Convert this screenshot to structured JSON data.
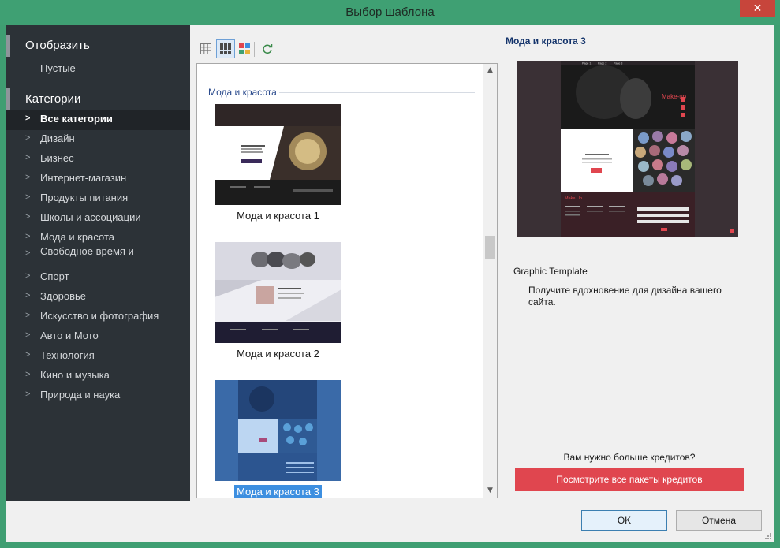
{
  "window": {
    "title": "Выбор шаблона",
    "close_glyph": "✕"
  },
  "sidebar": {
    "display_header": "Отобразить",
    "display_items": [
      "Пустые"
    ],
    "categories_header": "Категории",
    "chevron": ">",
    "categories": [
      {
        "label": "Все категории",
        "selected": true
      },
      {
        "label": "Дизайн"
      },
      {
        "label": "Бизнес"
      },
      {
        "label": "Интернет-магазин"
      },
      {
        "label": "Продукты питания"
      },
      {
        "label": "Школы и ассоциации"
      },
      {
        "label": "Мода и красота"
      },
      {
        "label": "Свободное время и"
      },
      {
        "label": "Спорт"
      },
      {
        "label": "Здоровье"
      },
      {
        "label": "Искусство и фотография"
      },
      {
        "label": "Авто и Мото"
      },
      {
        "label": "Технология"
      },
      {
        "label": "Кино и музыка"
      },
      {
        "label": "Природа и наука"
      }
    ]
  },
  "toolbar": {
    "buttons": [
      {
        "name": "small-grid-view-icon",
        "selected": false
      },
      {
        "name": "medium-grid-view-icon",
        "selected": true
      },
      {
        "name": "color-grid-view-icon",
        "selected": false
      },
      {
        "name": "refresh-icon",
        "selected": false
      }
    ]
  },
  "list": {
    "group_title": "Мода и красота",
    "templates": [
      {
        "caption": "Мода и красота 1",
        "selected": false
      },
      {
        "caption": "Мода и красота 2",
        "selected": false
      },
      {
        "caption": "Мода и красота 3",
        "selected": true
      }
    ],
    "scroll_up_glyph": "▲",
    "scroll_down_glyph": "▼"
  },
  "preview": {
    "title": "Мода и красота 3",
    "image_text": {
      "nav": [
        "Page 1",
        "Page 2",
        "Page 3"
      ],
      "headline": "Make-up",
      "footer_heading": "Make Up"
    },
    "section_label": "Graphic Template",
    "description": "Получите вдохновение для дизайна вашего сайта."
  },
  "credits": {
    "question": "Вам нужно больше кредитов?",
    "button_label": "Посмотрите все пакеты кредитов"
  },
  "footer": {
    "ok_label": "OK",
    "cancel_label": "Отмена"
  },
  "colors": {
    "title_bar": "#3fa073",
    "sidebar_bg": "#2c3237",
    "accent_red": "#e0464f",
    "selection_blue": "#3d8fe0"
  }
}
